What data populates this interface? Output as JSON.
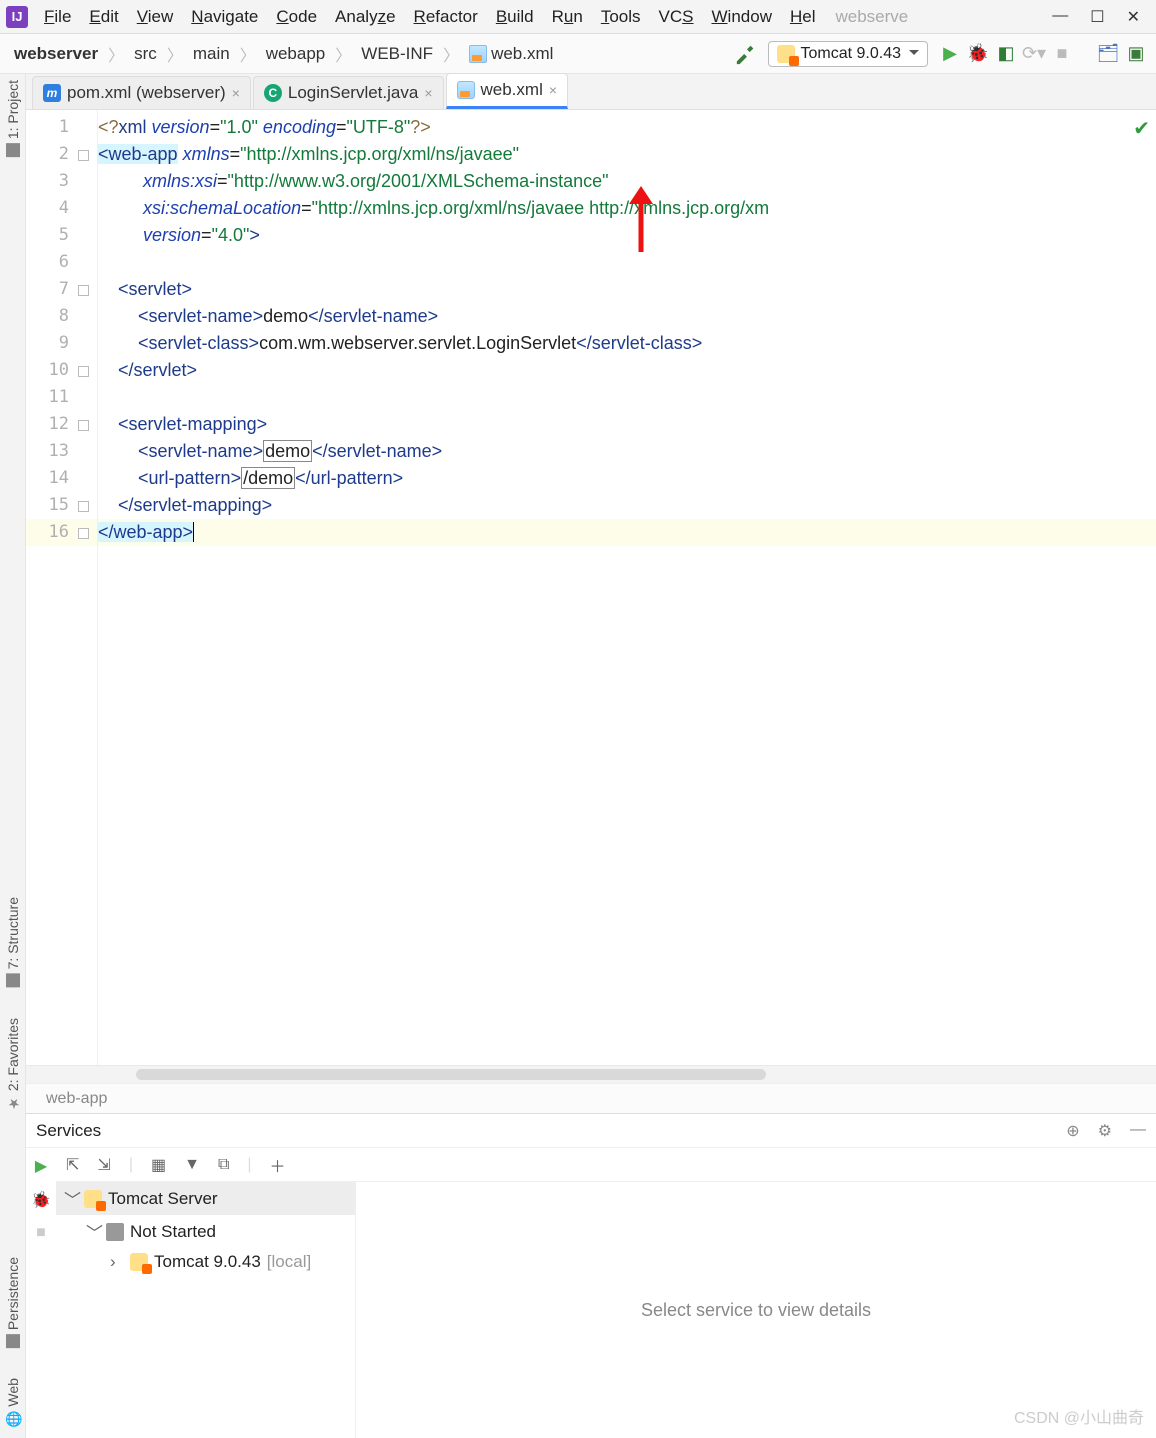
{
  "menu": {
    "items": [
      "File",
      "Edit",
      "View",
      "Navigate",
      "Code",
      "Analyze",
      "Refactor",
      "Build",
      "Run",
      "Tools",
      "VCS",
      "Window",
      "Help"
    ],
    "search_placeholder": "webserve"
  },
  "breadcrumbs": {
    "project": "webserver",
    "p1": "src",
    "p2": "main",
    "p3": "webapp",
    "p4": "WEB-INF",
    "file": "web.xml"
  },
  "runconfig": {
    "label": "Tomcat 9.0.43"
  },
  "tabs": [
    {
      "label": "pom.xml (webserver)",
      "icon": "m",
      "active": false
    },
    {
      "label": "LoginServlet.java",
      "icon": "c",
      "active": false
    },
    {
      "label": "web.xml",
      "icon": "x",
      "active": true
    }
  ],
  "editor": {
    "breadcrumb": "web-app",
    "lines": [
      {
        "n": 1,
        "html": "<span class='t-pi'>&lt;?</span><span class='t-tag'>xml</span> <span class='t-attr'>version</span>=<span class='t-str'>\"1.0\"</span> <span class='t-attr'>encoding</span>=<span class='t-str'>\"UTF-8\"</span><span class='t-pi'>?&gt;</span>"
      },
      {
        "n": 2,
        "fold": true,
        "html": "<span class='hi-tag'>&lt;web-app</span><span class='t-tag'> </span><span class='t-attr'>xmlns</span>=<span class='t-str'>\"http://xmlns.jcp.org/xml/ns/javaee\"</span>"
      },
      {
        "n": 3,
        "html": "         <span class='t-attr'>xmlns:xsi</span>=<span class='t-str'>\"http://www.w3.org/2001/XMLSchema-instance\"</span>"
      },
      {
        "n": 4,
        "html": "         <span class='t-attr'>xsi:schemaLocation</span>=<span class='t-str'>\"http://xmlns.jcp.org/xml/ns/javaee http://xmlns.jcp.org/xm</span>"
      },
      {
        "n": 5,
        "html": "         <span class='t-attr'>version</span>=<span class='t-str'>\"4.0\"</span><span class='t-tag'>&gt;</span>"
      },
      {
        "n": 6,
        "html": ""
      },
      {
        "n": 7,
        "fold": true,
        "html": "    <span class='t-tag'>&lt;servlet&gt;</span>"
      },
      {
        "n": 8,
        "html": "        <span class='t-tag'>&lt;servlet-name&gt;</span><span class='t-txt'>demo</span><span class='t-tag'>&lt;/servlet-name&gt;</span>"
      },
      {
        "n": 9,
        "html": "        <span class='t-tag'>&lt;servlet-class&gt;</span><span class='t-txt'>com.wm.webserver.servlet.LoginServlet</span><span class='t-tag'>&lt;/servlet-class&gt;</span>"
      },
      {
        "n": 10,
        "fold": true,
        "html": "    <span class='t-tag'>&lt;/servlet&gt;</span>"
      },
      {
        "n": 11,
        "html": ""
      },
      {
        "n": 12,
        "fold": true,
        "html": "    <span class='t-tag'>&lt;servlet-mapping&gt;</span>"
      },
      {
        "n": 13,
        "html": "        <span class='t-tag'>&lt;servlet-name&gt;</span><span class='boxed'>demo</span><span class='t-tag'>&lt;/servlet-name&gt;</span>"
      },
      {
        "n": 14,
        "html": "        <span class='t-tag'>&lt;url-pattern&gt;</span><span class='boxed'>/demo</span><span class='t-tag'>&lt;/url-pattern&gt;</span>"
      },
      {
        "n": 15,
        "fold": true,
        "html": "    <span class='t-tag'>&lt;/servlet-mapping&gt;</span>"
      },
      {
        "n": 16,
        "fold": true,
        "hl": true,
        "html": "<span class='hi-tag'>&lt;/web-app&gt;</span><span class='caret'></span>"
      }
    ]
  },
  "services": {
    "title": "Services",
    "detail_placeholder": "Select service to view details",
    "tree": {
      "root": "Tomcat Server",
      "child": "Not Started",
      "leaf": "Tomcat 9.0.43",
      "leaf_suffix": "[local]"
    }
  },
  "left_rail": {
    "project": "1: Project",
    "structure": "7: Structure",
    "favorites": "2: Favorites",
    "persistence": "Persistence",
    "web": "Web"
  },
  "watermark": "CSDN @小山曲奇"
}
